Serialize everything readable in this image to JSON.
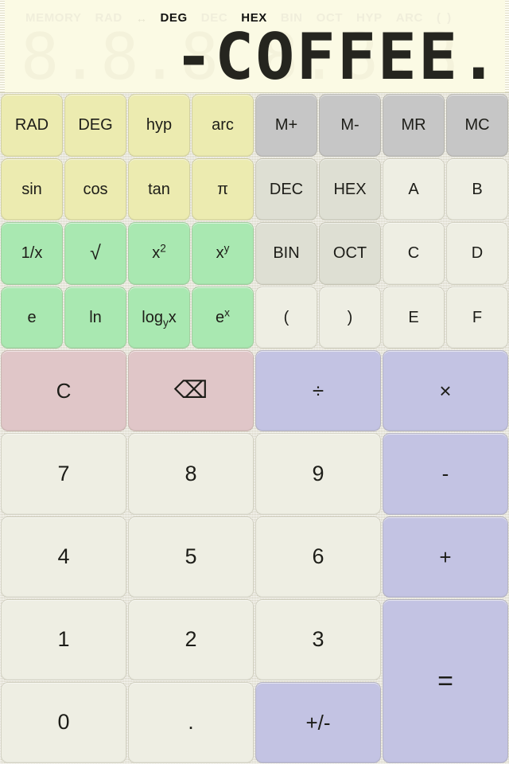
{
  "display": {
    "status_indicators": [
      {
        "label": "MEMORY",
        "active": false
      },
      {
        "label": "RAD",
        "active": false
      },
      {
        "label": "↔",
        "active": false
      },
      {
        "label": "DEG",
        "active": true
      },
      {
        "label": "DEC",
        "active": false
      },
      {
        "label": "HEX",
        "active": true
      },
      {
        "label": "BIN",
        "active": false
      },
      {
        "label": "OCT",
        "active": false
      },
      {
        "label": "HYP",
        "active": false
      },
      {
        "label": "ARC",
        "active": false
      },
      {
        "label": "( )",
        "active": false
      }
    ],
    "ghost_digits": "8.8.8.8.8.8.8.8.",
    "value": "-COFFEE.",
    "background_color": "#fbfae4",
    "active_segment_color": "#25251f",
    "inactive_segment_color": "#f4f2db"
  },
  "colors": {
    "body_background": "#e9e7da",
    "yellow": "#ecebb0",
    "green": "#a9e8b1",
    "gray": "#c6c6c6",
    "base_gray": "#dedfd3",
    "light": "#eeeee3",
    "pink": "#e0c6c8",
    "lavender": "#c3c3e3"
  },
  "keys": {
    "rad": "RAD",
    "deg": "DEG",
    "hyp": "hyp",
    "arc": "arc",
    "m_plus": "M+",
    "m_minus": "M-",
    "mr": "MR",
    "mc": "MC",
    "sin": "sin",
    "cos": "cos",
    "tan": "tan",
    "pi": "π",
    "dec": "DEC",
    "hex": "HEX",
    "hex_a": "A",
    "hex_b": "B",
    "reciprocal": "1/x",
    "sqrt": "√",
    "square_base": "x",
    "square_exp": "2",
    "power_base": "x",
    "power_exp": "y",
    "bin": "BIN",
    "oct": "OCT",
    "hex_c": "C",
    "hex_d": "D",
    "euler": "e",
    "ln": "ln",
    "log_prefix": "log",
    "log_sub": "y",
    "log_suffix": "x",
    "exp_base": "e",
    "exp_sup": "x",
    "paren_open": "(",
    "paren_close": ")",
    "hex_e": "E",
    "hex_f": "F",
    "clear": "C",
    "backspace": "⌫",
    "divide": "÷",
    "multiply": "×",
    "seven": "7",
    "eight": "8",
    "nine": "9",
    "minus": "-",
    "four": "4",
    "five": "5",
    "six": "6",
    "plus": "+",
    "one": "1",
    "two": "2",
    "three": "3",
    "equals": "=",
    "zero": "0",
    "decimal_point": ".",
    "sign_toggle": "+/-"
  }
}
